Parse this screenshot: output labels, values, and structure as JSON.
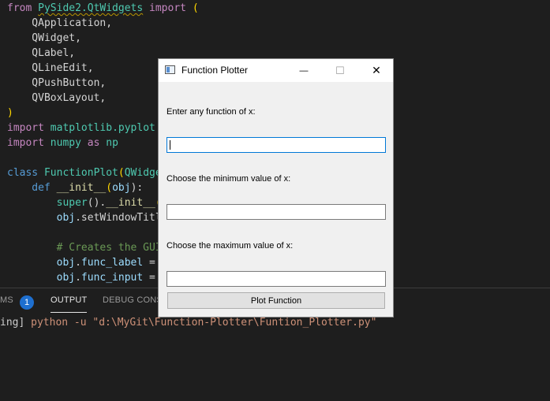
{
  "editor": {
    "lines": [
      {
        "parts": [
          {
            "t": "from ",
            "c": "kw"
          },
          {
            "t": "PySide2.QtWidgets",
            "c": "cls squig"
          },
          {
            "t": " import ",
            "c": "kw"
          },
          {
            "t": "(",
            "c": "brk"
          }
        ]
      },
      {
        "parts": [
          {
            "t": "    QApplication,",
            "c": ""
          }
        ]
      },
      {
        "parts": [
          {
            "t": "    QWidget,",
            "c": ""
          }
        ]
      },
      {
        "parts": [
          {
            "t": "    QLabel,",
            "c": ""
          }
        ]
      },
      {
        "parts": [
          {
            "t": "    QLineEdit,",
            "c": ""
          }
        ]
      },
      {
        "parts": [
          {
            "t": "    QPushButton,",
            "c": ""
          }
        ]
      },
      {
        "parts": [
          {
            "t": "    QVBoxLayout,",
            "c": ""
          }
        ]
      },
      {
        "parts": [
          {
            "t": ")",
            "c": "brk"
          }
        ]
      },
      {
        "parts": [
          {
            "t": "import ",
            "c": "kw"
          },
          {
            "t": "matplotlib.pyplot",
            "c": "cls"
          }
        ]
      },
      {
        "parts": [
          {
            "t": "import ",
            "c": "kw"
          },
          {
            "t": "numpy",
            "c": "cls"
          },
          {
            "t": " as ",
            "c": "kw"
          },
          {
            "t": "np",
            "c": "cls"
          }
        ]
      },
      {
        "parts": [
          {
            "t": "",
            "c": ""
          }
        ]
      },
      {
        "parts": [
          {
            "t": "class ",
            "c": "kw2"
          },
          {
            "t": "FunctionPlot",
            "c": "cls"
          },
          {
            "t": "(",
            "c": "brk"
          },
          {
            "t": "QWidge",
            "c": "cls"
          }
        ]
      },
      {
        "parts": [
          {
            "t": "    def ",
            "c": "kw2"
          },
          {
            "t": "__init__",
            "c": "fn"
          },
          {
            "t": "(",
            "c": "brk"
          },
          {
            "t": "obj",
            "c": "var"
          },
          {
            "t": "):",
            "c": ""
          }
        ]
      },
      {
        "parts": [
          {
            "t": "        super",
            "c": "cls"
          },
          {
            "t": "().",
            "c": ""
          },
          {
            "t": "__init__",
            "c": "fn"
          },
          {
            "t": "(",
            "c": "brk"
          }
        ]
      },
      {
        "parts": [
          {
            "t": "        obj",
            "c": "var"
          },
          {
            "t": ".setWindowTitl",
            "c": ""
          }
        ]
      },
      {
        "parts": [
          {
            "t": "",
            "c": ""
          }
        ]
      },
      {
        "parts": [
          {
            "t": "        # Creates the GUI",
            "c": "cmt"
          }
        ]
      },
      {
        "parts": [
          {
            "t": "        obj",
            "c": "var"
          },
          {
            "t": ".",
            "c": ""
          },
          {
            "t": "func_label",
            "c": "var"
          },
          {
            "t": " = ",
            "c": ""
          }
        ]
      },
      {
        "parts": [
          {
            "t": "        obj",
            "c": "var"
          },
          {
            "t": ".",
            "c": ""
          },
          {
            "t": "func_input",
            "c": "var"
          },
          {
            "t": " = ",
            "c": ""
          }
        ]
      }
    ]
  },
  "panel": {
    "tabs": [
      {
        "label": "MS",
        "name": "tab-problems",
        "active": false
      },
      {
        "label": "OUTPUT",
        "name": "tab-output",
        "active": true
      },
      {
        "label": "DEBUG CONSOLE",
        "name": "tab-debug-console",
        "active": false
      }
    ],
    "problems_count": "1",
    "terminal_prefix": "ing] ",
    "terminal_cmd": "python -u \"d:\\MyGit\\Function-Plotter\\Funtion_Plotter.py\""
  },
  "dialog": {
    "title": "Function Plotter",
    "minimize_glyph": "—",
    "maximize_glyph": "☐",
    "close_glyph": "✕",
    "func_label": "Enter any function of x:",
    "func_value": "",
    "min_label": "Choose the minimum value of x:",
    "min_value": "",
    "max_label": "Choose the maximum value of x:",
    "max_value": "",
    "plot_button": "Plot Function"
  }
}
